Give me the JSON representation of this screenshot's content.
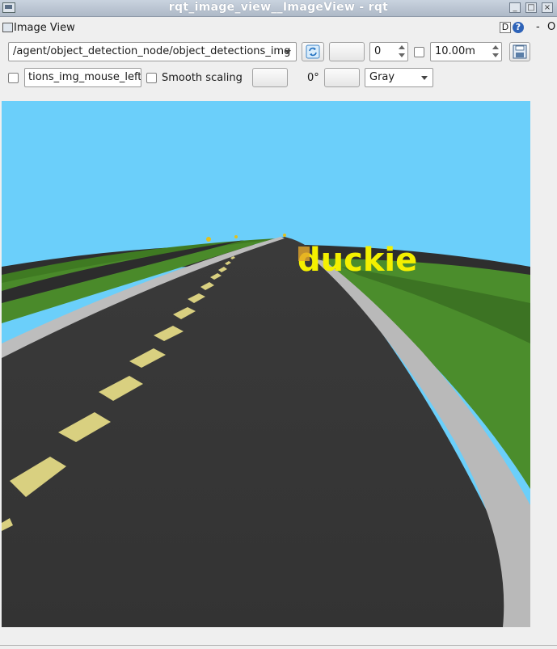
{
  "window": {
    "title": "rqt_image_view__ImageView - rqt",
    "controls": [
      "_",
      "□",
      "×"
    ]
  },
  "dock": {
    "title": "Image View",
    "d_label": "D",
    "help_label": "?",
    "dash": "-",
    "close": "O"
  },
  "toolbar": {
    "topic": "/agent/object_detection_node/object_detections_img",
    "numeric_value": "0",
    "timeout": "10.00m",
    "mouse_topic": "tions_img_mouse_left",
    "smooth_scaling_label": "Smooth scaling",
    "rotation": "0°",
    "color_scheme": "Gray"
  },
  "image": {
    "detection_label": "duckie",
    "detection_color": "#f4f000",
    "sky_color": "#6bcffa"
  }
}
